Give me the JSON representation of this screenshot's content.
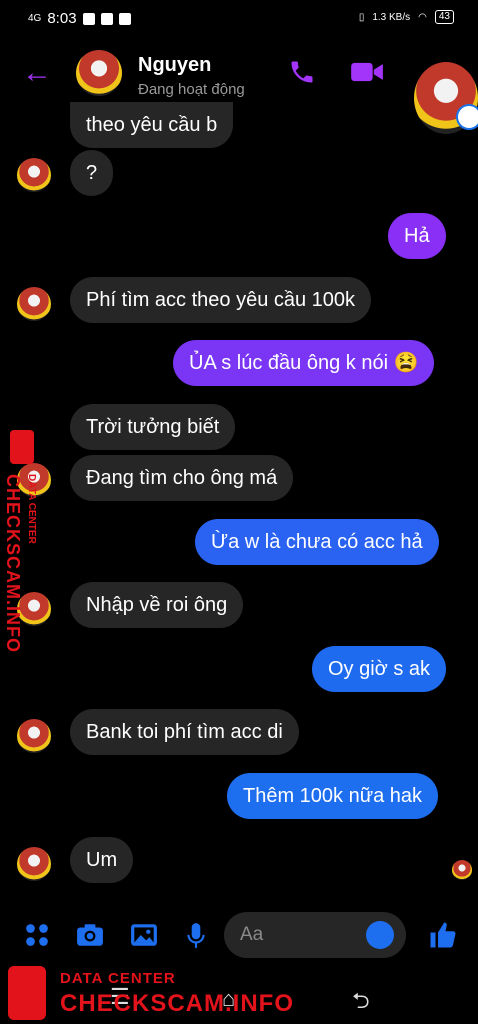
{
  "status_bar": {
    "network": "4G",
    "time": "8:03",
    "speed": "1.3 KB/s",
    "battery": "43"
  },
  "header": {
    "name": "Nguyen",
    "status": "Đang hoạt động"
  },
  "messages": [
    {
      "side": "in",
      "text": "theo yêu cầu b"
    },
    {
      "side": "in",
      "text": "?"
    },
    {
      "side": "out",
      "text": "Hả"
    },
    {
      "side": "in",
      "text": "Phí tìm acc theo yêu cầu 100k"
    },
    {
      "side": "out",
      "text": "ỦA s lúc đầu ông k nói 😫"
    },
    {
      "side": "in",
      "text": "Trời tưởng biết"
    },
    {
      "side": "in",
      "text": "Đang tìm cho ông má"
    },
    {
      "side": "out",
      "text": "Ừa w là chưa có acc hả"
    },
    {
      "side": "in",
      "text": "Nhập về roi ông"
    },
    {
      "side": "out",
      "text": "Oy giờ s ak"
    },
    {
      "side": "in",
      "text": "Bank toi phí tìm acc di"
    },
    {
      "side": "out",
      "text": "Thêm 100k nữa hak"
    },
    {
      "side": "in",
      "text": "Um"
    }
  ],
  "composer": {
    "placeholder": "Aa"
  },
  "watermark": {
    "line1": "DATA CENTER",
    "line2": "CHECKSCAM.INFO"
  },
  "colors": {
    "accent": "#a334fa",
    "outgoing_top": "#8a2ff5",
    "outgoing_bottom": "#1e6ef0",
    "incoming": "#262626"
  }
}
